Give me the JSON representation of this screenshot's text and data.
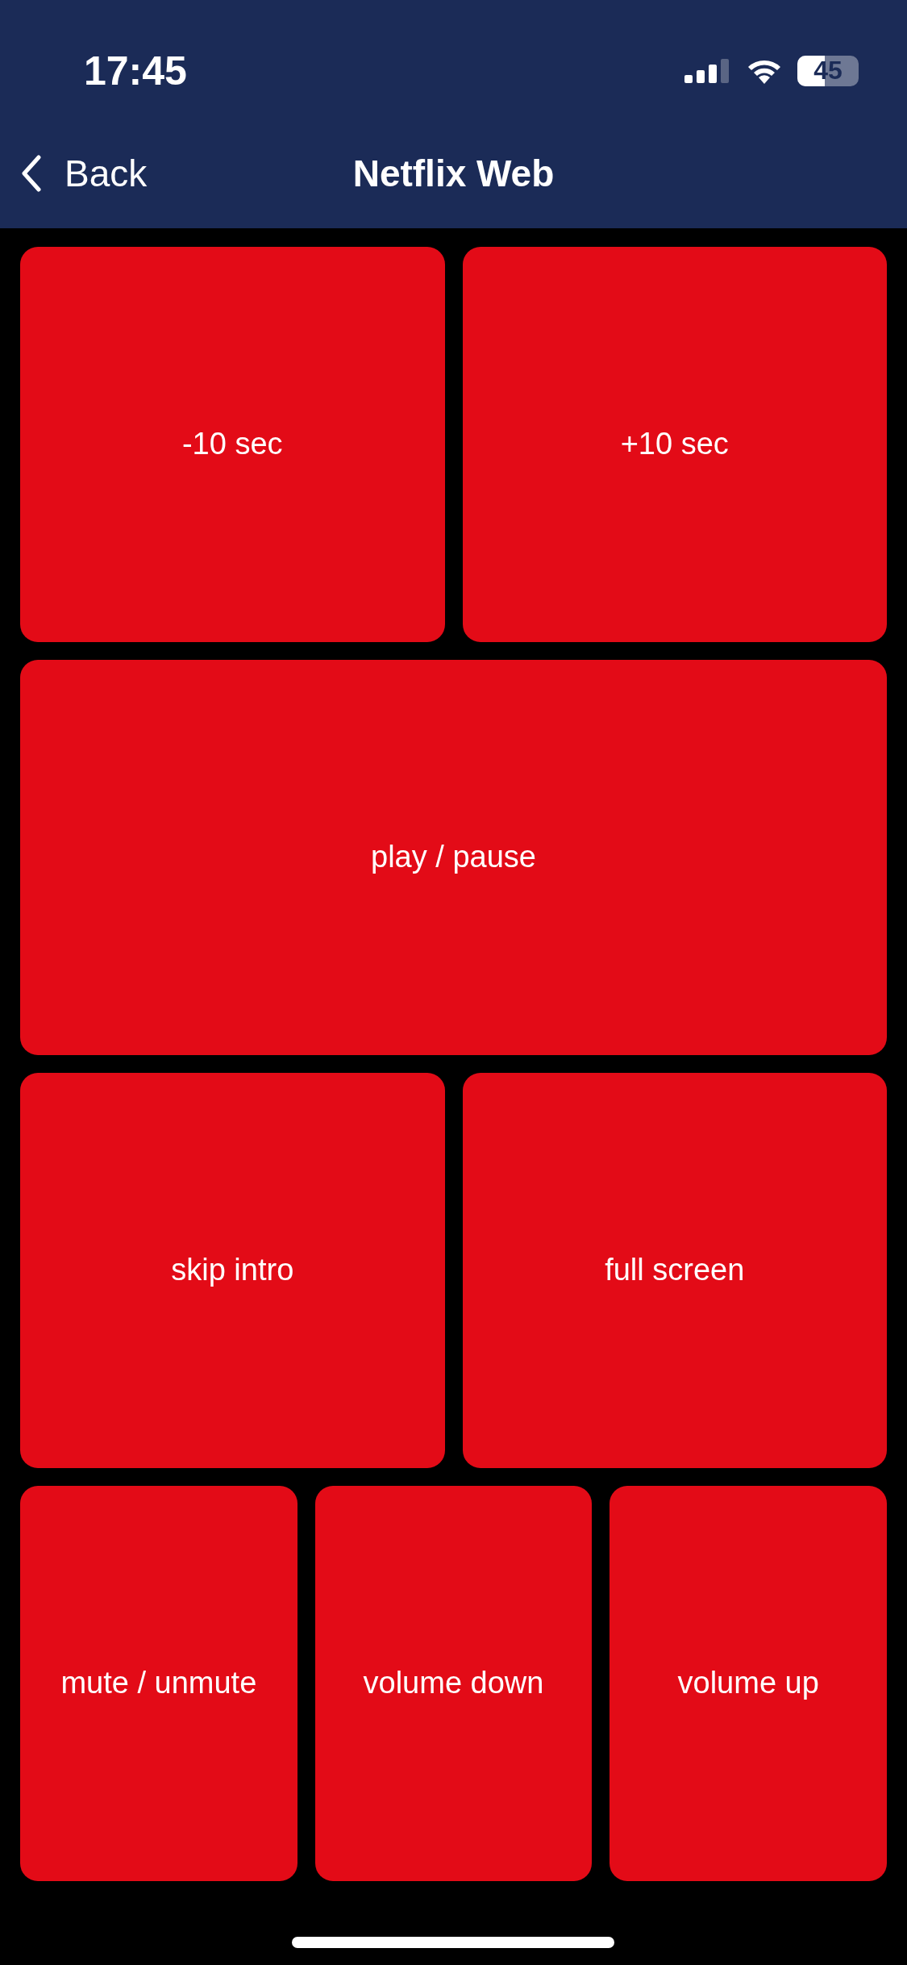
{
  "status_bar": {
    "time": "17:45",
    "battery": "45"
  },
  "nav": {
    "back": "Back",
    "title": "Netflix Web"
  },
  "rows": [
    [
      "-10 sec",
      "+10 sec"
    ],
    [
      "play / pause"
    ],
    [
      "skip intro",
      "full screen"
    ],
    [
      "mute / unmute",
      "volume down",
      "volume up"
    ]
  ]
}
